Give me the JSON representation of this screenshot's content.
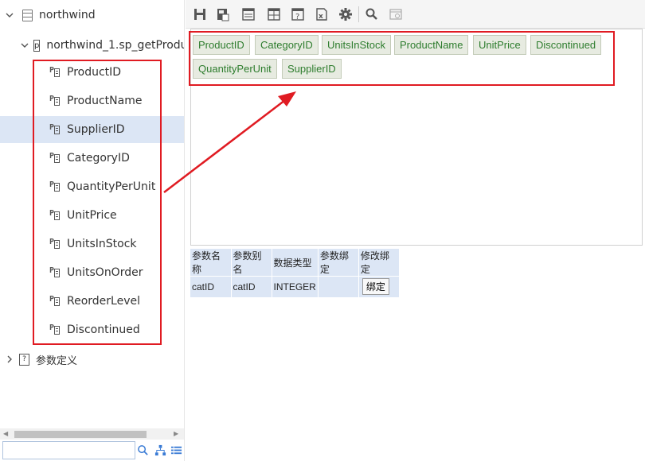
{
  "tree": {
    "root_label": "northwind",
    "proc_label": "northwind_1.sp_getProdu",
    "fields": [
      "ProductID",
      "ProductName",
      "SupplierID",
      "CategoryID",
      "QuantityPerUnit",
      "UnitPrice",
      "UnitsInStock",
      "UnitsOnOrder",
      "ReorderLevel",
      "Discontinued"
    ],
    "selected_field": "SupplierID",
    "param_def_label": "参数定义"
  },
  "search": {
    "placeholder": ""
  },
  "toolbar": {
    "icons": [
      "save-icon",
      "save-as-icon",
      "layout-icon",
      "grid-icon",
      "help-icon",
      "excel-icon",
      "gear-icon",
      "search-icon",
      "preview-icon"
    ]
  },
  "canvas": {
    "chips": [
      "ProductID",
      "CategoryID",
      "UnitsInStock",
      "ProductName",
      "UnitPrice",
      "Discontinued",
      "QuantityPerUnit",
      "SupplierID"
    ]
  },
  "params": {
    "headers": [
      "参数名称",
      "参数别名",
      "数据类型",
      "参数绑定",
      "修改绑定"
    ],
    "row": {
      "name": "catID",
      "alias": "catID",
      "type": "INTEGER",
      "binding": "",
      "button": "绑定"
    }
  },
  "colors": {
    "highlight_red": "#e01b22",
    "selection": "#dce6f5",
    "chip_text": "#2e7d2e"
  }
}
